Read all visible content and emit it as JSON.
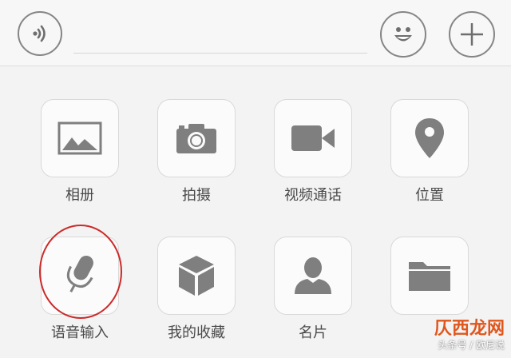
{
  "toolbar": {
    "voice_icon": "voice-wave-icon",
    "emoji_icon": "smiley-icon",
    "plus_icon": "plus-icon"
  },
  "panel": {
    "items": [
      {
        "label": "相册",
        "icon": "image-icon"
      },
      {
        "label": "拍摄",
        "icon": "camera-icon"
      },
      {
        "label": "视频通话",
        "icon": "video-camera-icon"
      },
      {
        "label": "位置",
        "icon": "location-pin-icon"
      },
      {
        "label": "语音输入",
        "icon": "microphone-icon"
      },
      {
        "label": "我的收藏",
        "icon": "cube-icon"
      },
      {
        "label": "名片",
        "icon": "person-icon"
      },
      {
        "label": "",
        "icon": "folder-icon"
      }
    ]
  },
  "watermark": {
    "logo": "仄西龙网",
    "sub": "头条号 / 欧尼说"
  },
  "colors": {
    "icon_gray": "#7f7f7f",
    "highlight_red": "#cc2a2a"
  }
}
